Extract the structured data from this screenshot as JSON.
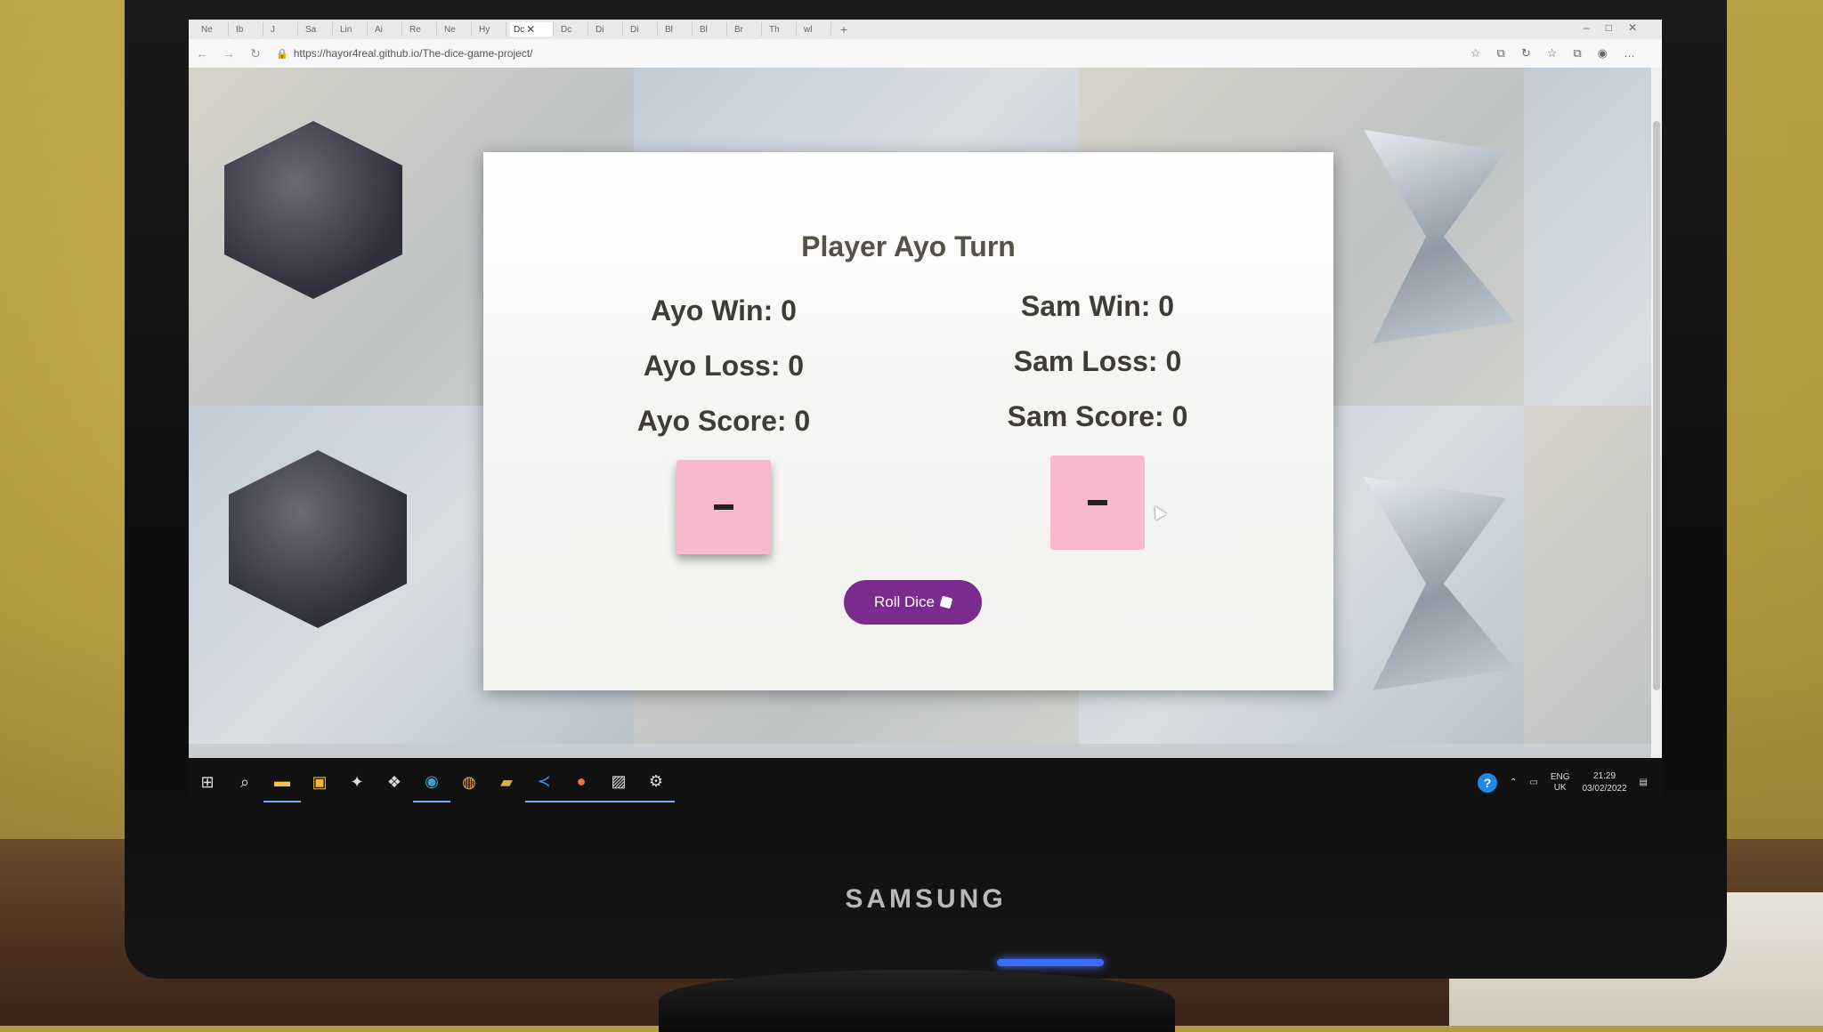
{
  "browser": {
    "tabs": [
      "Ne",
      "Ib",
      "J",
      "Sa",
      "Lin",
      "Ai",
      "Re",
      "Ne",
      "Hy",
      "Dc",
      "Dc",
      "Di",
      "Di",
      "Bl",
      "Bl",
      "Br",
      "Th",
      "wl"
    ],
    "active_tab": "Dc",
    "url": "https://hayor4real.github.io/The-dice-game-project/",
    "new_tab_symbol": "+"
  },
  "game": {
    "turn_title": "Player Ayo Turn",
    "player1": {
      "win": "Ayo Win: 0",
      "loss": "Ayo Loss: 0",
      "score": "Ayo Score: 0"
    },
    "player2": {
      "win": "Sam Win: 0",
      "loss": "Sam Loss: 0",
      "score": "Sam Score: 0"
    },
    "roll_button": "Roll Dice",
    "dice_box_color": "#f7b9cb",
    "button_color": "#7b2a8e"
  },
  "taskbar": {
    "icons": [
      "windows-start-icon",
      "search-icon",
      "file-explorer-icon",
      "store-icon",
      "app-icon",
      "dropbox-icon",
      "edge-icon",
      "chrome-icon",
      "folder-icon",
      "vscode-icon",
      "firefox-icon",
      "photos-icon",
      "settings-icon"
    ],
    "lang_top": "ENG",
    "lang_bottom": "UK",
    "time": "21:29",
    "date": "03/02/2022"
  },
  "monitor": {
    "brand": "SAMSUNG"
  }
}
